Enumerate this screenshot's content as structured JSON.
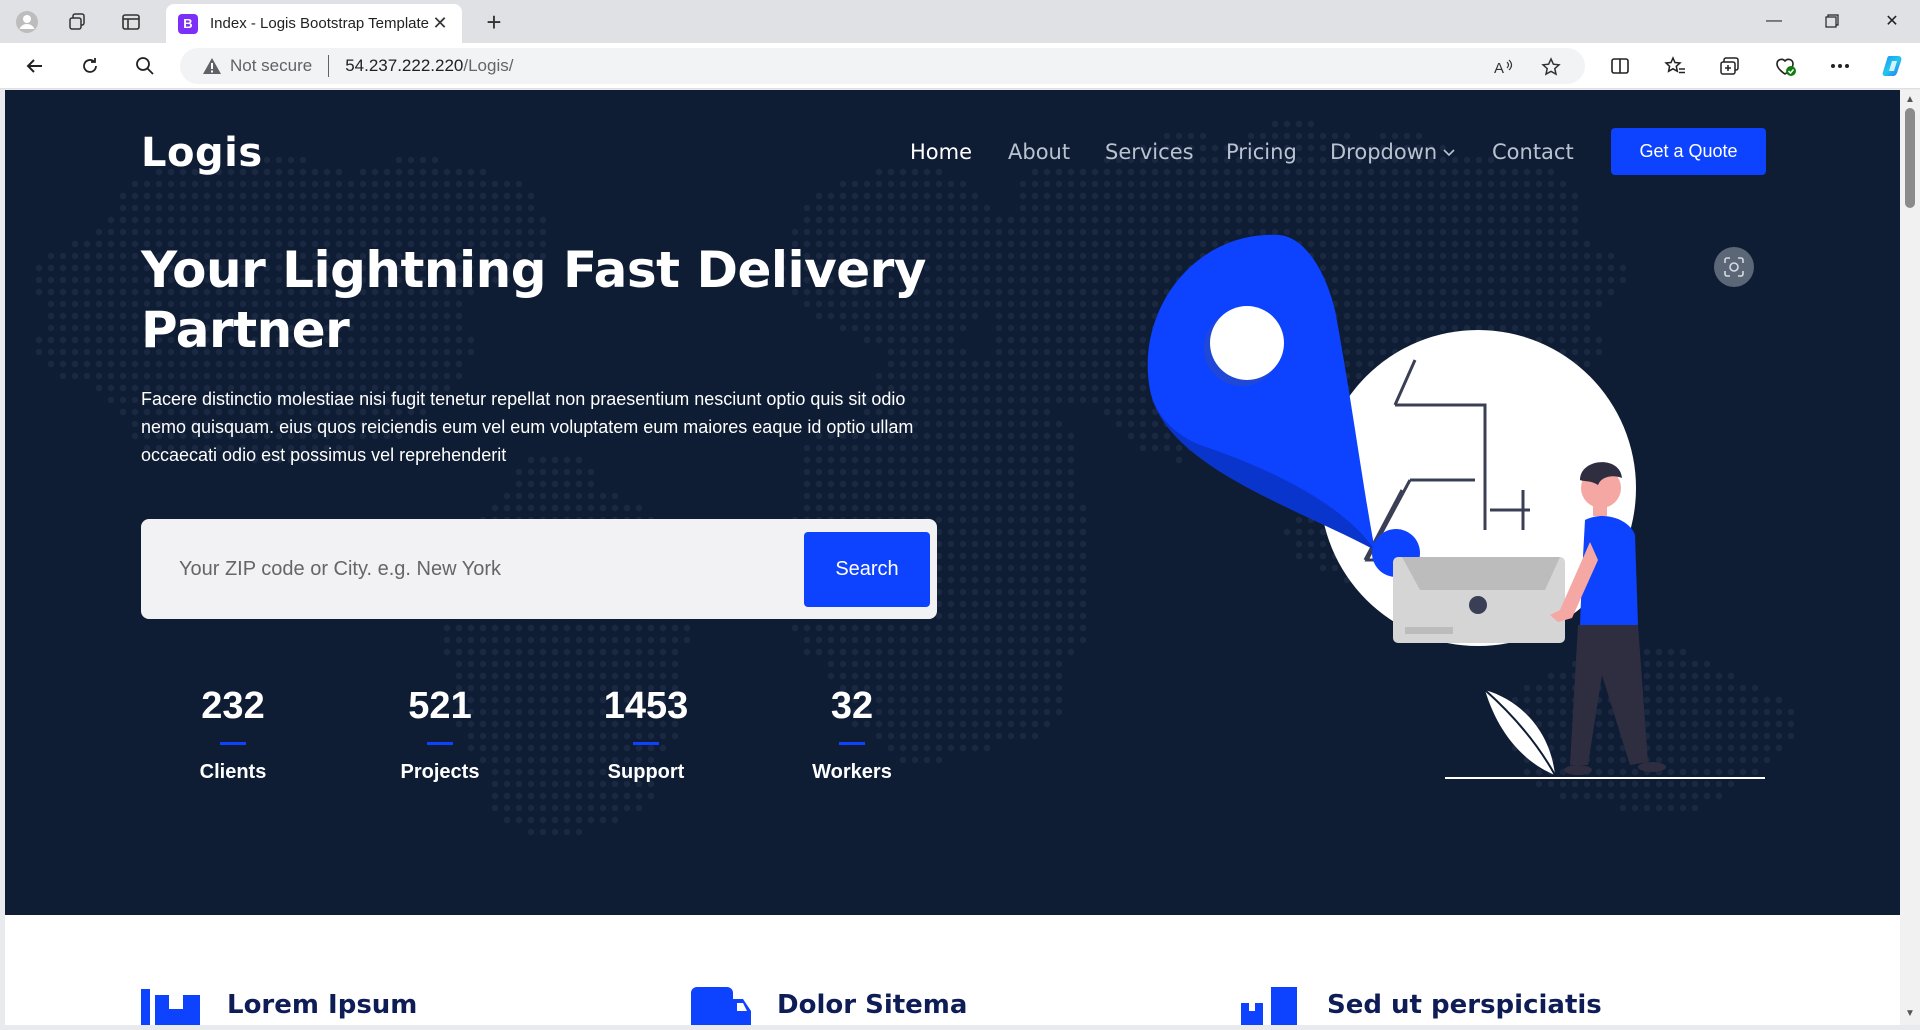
{
  "browser": {
    "tab_title": "Index - Logis Bootstrap Template",
    "tab_favicon": "B",
    "not_secure_label": "Not secure",
    "url_host": "54.237.222.220",
    "url_path": "/Logis/"
  },
  "site": {
    "logo": "Logis",
    "nav": {
      "home": "Home",
      "about": "About",
      "services": "Services",
      "pricing": "Pricing",
      "dropdown": "Dropdown",
      "contact": "Contact"
    },
    "quote_button": "Get a Quote",
    "accent_color": "#0d42ff",
    "hero_bg": "#0e1d34"
  },
  "hero": {
    "title": "Your Lightning Fast Delivery Partner",
    "text": "Facere distinctio molestiae nisi fugit tenetur repellat non praesentium nesciunt optio quis sit odio nemo quisquam. eius quos reiciendis eum vel eum voluptatem eum maiores eaque id optio ullam occaecati odio est possimus vel reprehenderit",
    "search_placeholder": "Your ZIP code or City. e.g. New York",
    "search_button": "Search"
  },
  "stats": [
    {
      "value": "232",
      "label": "Clients"
    },
    {
      "value": "521",
      "label": "Projects"
    },
    {
      "value": "1453",
      "label": "Support"
    },
    {
      "value": "32",
      "label": "Workers"
    }
  ],
  "features": [
    {
      "title": "Lorem Ipsum",
      "icon": "cart-flatbed-icon"
    },
    {
      "title": "Dolor Sitema",
      "icon": "truck-icon"
    },
    {
      "title": "Sed ut perspiciatis",
      "icon": "boxes-icon"
    }
  ]
}
